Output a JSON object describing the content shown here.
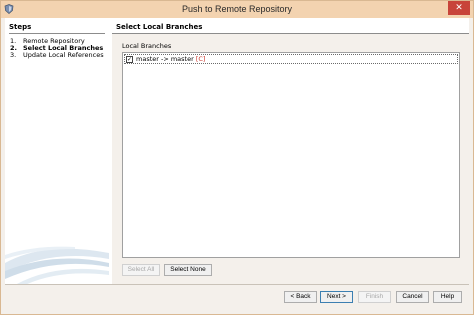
{
  "window": {
    "title": "Push to Remote Repository",
    "close_label": "✕"
  },
  "steps": {
    "title": "Steps",
    "items": [
      {
        "num": "1.",
        "label": "Remote Repository",
        "active": false
      },
      {
        "num": "2.",
        "label": "Select Local Branches",
        "active": true
      },
      {
        "num": "3.",
        "label": "Update Local References",
        "active": false
      }
    ]
  },
  "content": {
    "title": "Select Local Branches",
    "list_label": "Local Branches",
    "branches": [
      {
        "checked": true,
        "check_glyph": "✓",
        "text": "master -> master ",
        "flag": "[C]"
      }
    ],
    "select_all_label": "Select All",
    "select_none_label": "Select None"
  },
  "footer": {
    "back_label": "< Back",
    "next_label": "Next >",
    "finish_label": "Finish",
    "cancel_label": "Cancel",
    "help_label": "Help"
  },
  "colors": {
    "titlebar": "#f3d3b0",
    "close": "#c8443a",
    "branch_flag": "#c8342a"
  }
}
